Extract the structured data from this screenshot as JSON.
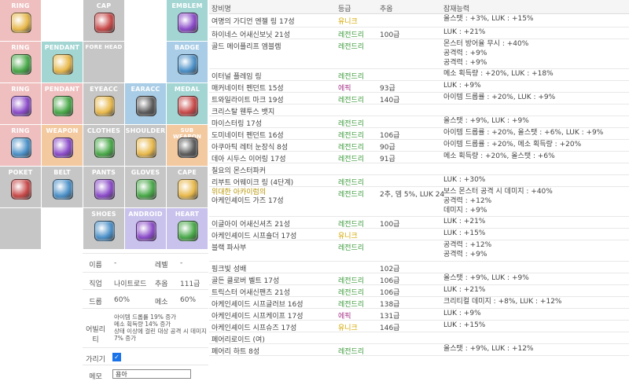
{
  "slots": [
    {
      "label": "RING",
      "color": "red",
      "icon": "ring-icon"
    },
    {
      "label": "",
      "color": "empty",
      "icon": ""
    },
    {
      "label": "CAP",
      "color": "grey",
      "icon": "cap-icon"
    },
    {
      "label": "",
      "color": "empty",
      "icon": ""
    },
    {
      "label": "EMBLEM",
      "color": "teal",
      "icon": "emblem-icon"
    },
    {
      "label": "RING",
      "color": "red",
      "icon": "ring-icon"
    },
    {
      "label": "PENDANT",
      "color": "teal",
      "icon": "pendant-icon"
    },
    {
      "label": "FORE HEAD",
      "color": "grey",
      "icon": ""
    },
    {
      "label": "",
      "color": "empty",
      "icon": ""
    },
    {
      "label": "BADGE",
      "color": "blue",
      "icon": "badge-icon"
    },
    {
      "label": "RING",
      "color": "red",
      "icon": "ring-icon"
    },
    {
      "label": "PENDANT",
      "color": "red",
      "icon": "pendant-icon"
    },
    {
      "label": "EYEACC",
      "color": "grey",
      "icon": "eye-accessory-icon"
    },
    {
      "label": "EARACC",
      "color": "blue",
      "icon": "ear-accessory-icon"
    },
    {
      "label": "MEDAL",
      "color": "teal",
      "icon": "medal-icon"
    },
    {
      "label": "RING",
      "color": "red",
      "icon": "ring-icon"
    },
    {
      "label": "WEAPON",
      "color": "orange",
      "icon": "weapon-icon"
    },
    {
      "label": "CLOTHES",
      "color": "grey",
      "icon": "clothes-icon"
    },
    {
      "label": "SHOULDER",
      "color": "grey",
      "icon": "shoulder-icon"
    },
    {
      "label": "SUB WEAPON",
      "color": "orange",
      "icon": "sub-weapon-icon"
    },
    {
      "label": "POKET",
      "color": "grey",
      "icon": "pocket-icon"
    },
    {
      "label": "BELT",
      "color": "grey",
      "icon": "belt-icon"
    },
    {
      "label": "PANTS",
      "color": "grey",
      "icon": "pants-icon"
    },
    {
      "label": "GLOVES",
      "color": "grey",
      "icon": "gloves-icon"
    },
    {
      "label": "CAPE",
      "color": "grey",
      "icon": "cape-icon"
    },
    {
      "label": "",
      "color": "grey",
      "icon": ""
    },
    {
      "label": "",
      "color": "empty",
      "icon": ""
    },
    {
      "label": "SHOES",
      "color": "grey",
      "icon": "shoes-icon"
    },
    {
      "label": "ANDROID",
      "color": "purple",
      "icon": "android-icon"
    },
    {
      "label": "HEART",
      "color": "purple",
      "icon": "heart-icon"
    }
  ],
  "slot_colors": {
    "red": "#efbfbf",
    "grey": "#c6c6c6",
    "teal": "#a3d6d3",
    "blue": "#a9cde6",
    "orange": "#f3c9a0",
    "purple": "#c8c2ec",
    "empty": "#ffffff"
  },
  "icon_colors": [
    "#e8b84a",
    "#5a5a5a",
    "#c84848",
    "#4a90c8",
    "#8a4ac8",
    "#48a848"
  ],
  "info": {
    "name_label": "이름",
    "name_value": "-",
    "level_label": "레벨",
    "level_value": "-",
    "job_label": "직업",
    "job_value": "나이트로드",
    "starforce_label": "추옵",
    "starforce_value": "111급",
    "drop_label": "드롭",
    "drop_value": "60%",
    "meso_label": "메소",
    "meso_value": "60%",
    "ability_label": "어빌리티",
    "ability_lines": [
      "아이템 드롭률 19% 증가",
      "메소 획득량 14% 증가",
      "상태 이상에 걸린 대상 공격 시 데미지",
      "7% 증가"
    ],
    "hide_label": "가리기",
    "memo_label": "메모",
    "memo_value": "용아"
  },
  "table": {
    "headers": {
      "name": "장비명",
      "grade": "등급",
      "star": "추옵",
      "potential": "잠재능력"
    },
    "rows": [
      {
        "name": "여명의 가디언 엔젤 링 17성",
        "grade": "유니크",
        "g": "uni",
        "star": "",
        "pot": [
          "올스탯 : +3%, LUK : +15%"
        ],
        "h": 17
      },
      {
        "name": "하이네스 어새신보닛 21성",
        "grade": "레전드리",
        "g": "leg",
        "star": "100급",
        "pot": [
          "LUK : +21%"
        ],
        "h": 15
      },
      {
        "name": "골드 메이플리프 엠블렘",
        "grade": "레전드리",
        "g": "leg",
        "star": "",
        "pot": [
          "몬스터 방어율 무시 : +40%",
          "공격력 : +9%",
          "공격력 : +9%"
        ],
        "h": 38
      },
      {
        "name": "이터널 플레임 링",
        "grade": "레전드리",
        "g": "leg",
        "star": "",
        "pot": [
          "메소 획득량 : +20%, LUK : +18%"
        ],
        "h": 15
      },
      {
        "name": "매커네이터 펜던트 15성",
        "grade": "에픽",
        "g": "epic",
        "star": "93급",
        "pot": [
          "LUK : +9%"
        ],
        "h": 15
      },
      {
        "name": "트와일라이트 마크 19성",
        "grade": "레전드리",
        "g": "leg",
        "star": "140급",
        "pot": [
          "아이템 드롭률 : +20%, LUK : +9%"
        ],
        "h": 15
      },
      {
        "name": "크리스탈 웬투스 뱃지",
        "grade": "",
        "g": "",
        "star": "",
        "pot": [],
        "h": 15
      },
      {
        "name": "마이스터링 17성",
        "grade": "레전드리",
        "g": "leg",
        "star": "",
        "pot": [
          "올스탯 : +9%, LUK : +9%"
        ],
        "h": 15
      },
      {
        "name": "도미네이터 펜던트 16성",
        "grade": "레전드리",
        "g": "leg",
        "star": "106급",
        "pot": [
          "아이템 드롭률 : +20%, 올스탯 : +6%, LUK : +9%"
        ],
        "h": 15
      },
      {
        "name": "아쿠아틱 레터 눈장식 8성",
        "grade": "레전드리",
        "g": "leg",
        "star": "90급",
        "pot": [
          "아이템 드롭률 : +20%, 메소 획득량 : +20%"
        ],
        "h": 15
      },
      {
        "name": "데아 시두스 이어링 17성",
        "grade": "레전드리",
        "g": "leg",
        "star": "91급",
        "pot": [
          "메소 획득량 : +20%, 올스탯 : +6%"
        ],
        "h": 15
      },
      {
        "name": "칠요의 몬스터파커",
        "grade": "",
        "g": "",
        "star": "",
        "pot": [],
        "h": 15
      },
      {
        "name": "리부트 어웨이크 링 (4단계)",
        "grade": "레전드리",
        "g": "leg",
        "star": "",
        "pot": [
          "LUK : +30%"
        ],
        "h": 15
      },
      {
        "name": "위대한 아카이럼의",
        "name2": "아케인셰이드 가즈 17성",
        "grade": "레전드리",
        "g": "leg",
        "star": "2추, 뎀 5%, LUK 24",
        "pot": [
          "보스 몬스터 공격 시 데미지 : +40%",
          "공격력 : +12%",
          "데미지 : +9%"
        ],
        "h": 38
      },
      {
        "name": "이글아이 어새신셔츠 21성",
        "grade": "레전드리",
        "g": "leg",
        "star": "100급",
        "pot": [
          "LUK : +21%"
        ],
        "h": 15
      },
      {
        "name": "아케인셰이드 시프숄더 17성",
        "grade": "유니크",
        "g": "uni",
        "star": "",
        "pot": [
          "LUK : +15%"
        ],
        "h": 15
      },
      {
        "name": "블랙 파사부",
        "grade": "레전드리",
        "g": "leg",
        "star": "",
        "pot": [
          "공격력 : +12%",
          "공격력 : +9%"
        ],
        "h": 27
      },
      {
        "name": "핑크빛 성배",
        "grade": "",
        "g": "",
        "star": "102급",
        "pot": [],
        "h": 15
      },
      {
        "name": "골든 클로버 벨트 17성",
        "grade": "레전드리",
        "g": "leg",
        "star": "106급",
        "pot": [
          "올스탯 : +9%, LUK : +9%"
        ],
        "h": 15
      },
      {
        "name": "트릭스터 어새신팬츠 21성",
        "grade": "레전드리",
        "g": "leg",
        "star": "106급",
        "pot": [
          "LUK : +21%"
        ],
        "h": 15
      },
      {
        "name": "아케인셰이드 시프글러브 16성",
        "grade": "레전드리",
        "g": "leg",
        "star": "138급",
        "pot": [
          "크리티컬 데미지 : +8%, LUK : +12%"
        ],
        "h": 15
      },
      {
        "name": "아케인셰이드 시프케이프 17성",
        "grade": "에픽",
        "g": "epic",
        "star": "131급",
        "pot": [
          "LUK : +9%"
        ],
        "h": 15
      },
      {
        "name": "아케인셰이드 시프슈즈 17성",
        "grade": "유니크",
        "g": "uni",
        "star": "146급",
        "pot": [
          "LUK : +15%"
        ],
        "h": 15
      },
      {
        "name": "페어리로이드 (여)",
        "grade": "",
        "g": "",
        "star": "",
        "pot": [],
        "h": 15
      },
      {
        "name": "페어리 하트 8성",
        "grade": "레전드리",
        "g": "leg",
        "star": "",
        "pot": [
          "올스탯 : +9%, LUK : +12%"
        ],
        "h": 15
      }
    ]
  }
}
